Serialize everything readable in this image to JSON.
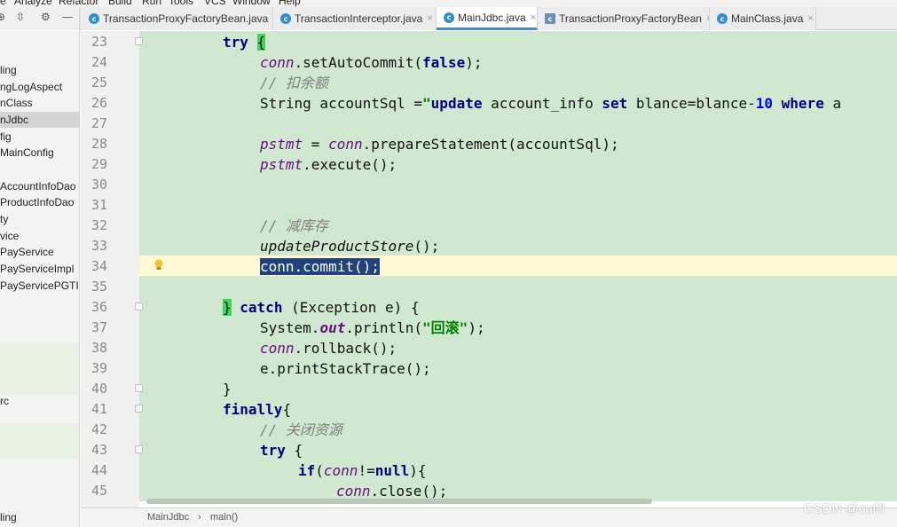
{
  "menubar": {
    "items": [
      "e",
      "Analyze",
      "Refactor",
      "Build",
      "Run",
      "Tools",
      "VCS",
      "Window",
      "Help"
    ]
  },
  "project_tools": {
    "settings_glyph": "⚙",
    "collapse_glyph": "—"
  },
  "tabs": [
    {
      "label": "TransactionProxyFactoryBean.java",
      "icon": "class-icon",
      "active": false
    },
    {
      "label": "TransactionInterceptor.java",
      "icon": "class-icon",
      "active": false
    },
    {
      "label": "MainJdbc.java",
      "icon": "class-icon",
      "active": true
    },
    {
      "label": "TransactionProxyFactoryBean",
      "icon": "class-file-icon",
      "active": false
    },
    {
      "label": "MainClass.java",
      "icon": "class-icon",
      "active": false
    }
  ],
  "tree": {
    "items": [
      "ling",
      "ngLogAspect",
      "nClass",
      "nJdbc",
      "fig",
      "MainConfig",
      "AccountInfoDao",
      "ProductInfoDao",
      "ty",
      "vice",
      "PayService",
      "PayServiceImpl",
      "PayServicePGTIm",
      "rc",
      "ling"
    ],
    "selected_index": 3
  },
  "editor": {
    "caret_line": 34,
    "lines": [
      {
        "n": "23",
        "text": "try {"
      },
      {
        "n": "24",
        "text": "conn.setAutoCommit(false);"
      },
      {
        "n": "25",
        "text": "// 扣余额"
      },
      {
        "n": "26",
        "text": "String accountSql =\"update account_info set blance=blance-10 where a"
      },
      {
        "n": "27",
        "text": ""
      },
      {
        "n": "28",
        "text": "pstmt = conn.prepareStatement(accountSql);"
      },
      {
        "n": "29",
        "text": "pstmt.execute();"
      },
      {
        "n": "30",
        "text": ""
      },
      {
        "n": "31",
        "text": ""
      },
      {
        "n": "32",
        "text": "// 减库存"
      },
      {
        "n": "33",
        "text": "updateProductStore();"
      },
      {
        "n": "34",
        "text": "conn.commit();"
      },
      {
        "n": "35",
        "text": ""
      },
      {
        "n": "36",
        "text": "} catch (Exception e) {"
      },
      {
        "n": "37",
        "text": "System.out.println(\"回滚\");"
      },
      {
        "n": "38",
        "text": "conn.rollback();"
      },
      {
        "n": "39",
        "text": "e.printStackTrace();"
      },
      {
        "n": "40",
        "text": "}"
      },
      {
        "n": "41",
        "text": "finally{"
      },
      {
        "n": "42",
        "text": "// 关闭资源"
      },
      {
        "n": "43",
        "text": "try {"
      },
      {
        "n": "44",
        "text": "if(conn!=null){"
      },
      {
        "n": "45",
        "text": "conn.close();"
      }
    ]
  },
  "breadcrumb": {
    "items": [
      "MainJdbc",
      "main()"
    ],
    "separator": "›"
  },
  "watermark": "CSDN @cuilll",
  "colors": {
    "code_background": "#cfe8cf",
    "caret_line_background": "#fff8d5",
    "keyword": "#000080",
    "string": "#008000",
    "comment": "#808080",
    "field": "#660e7a",
    "selection": "#21427d",
    "brace_match": "#3fd65e",
    "active_tab_underline": "#4a88c7"
  }
}
